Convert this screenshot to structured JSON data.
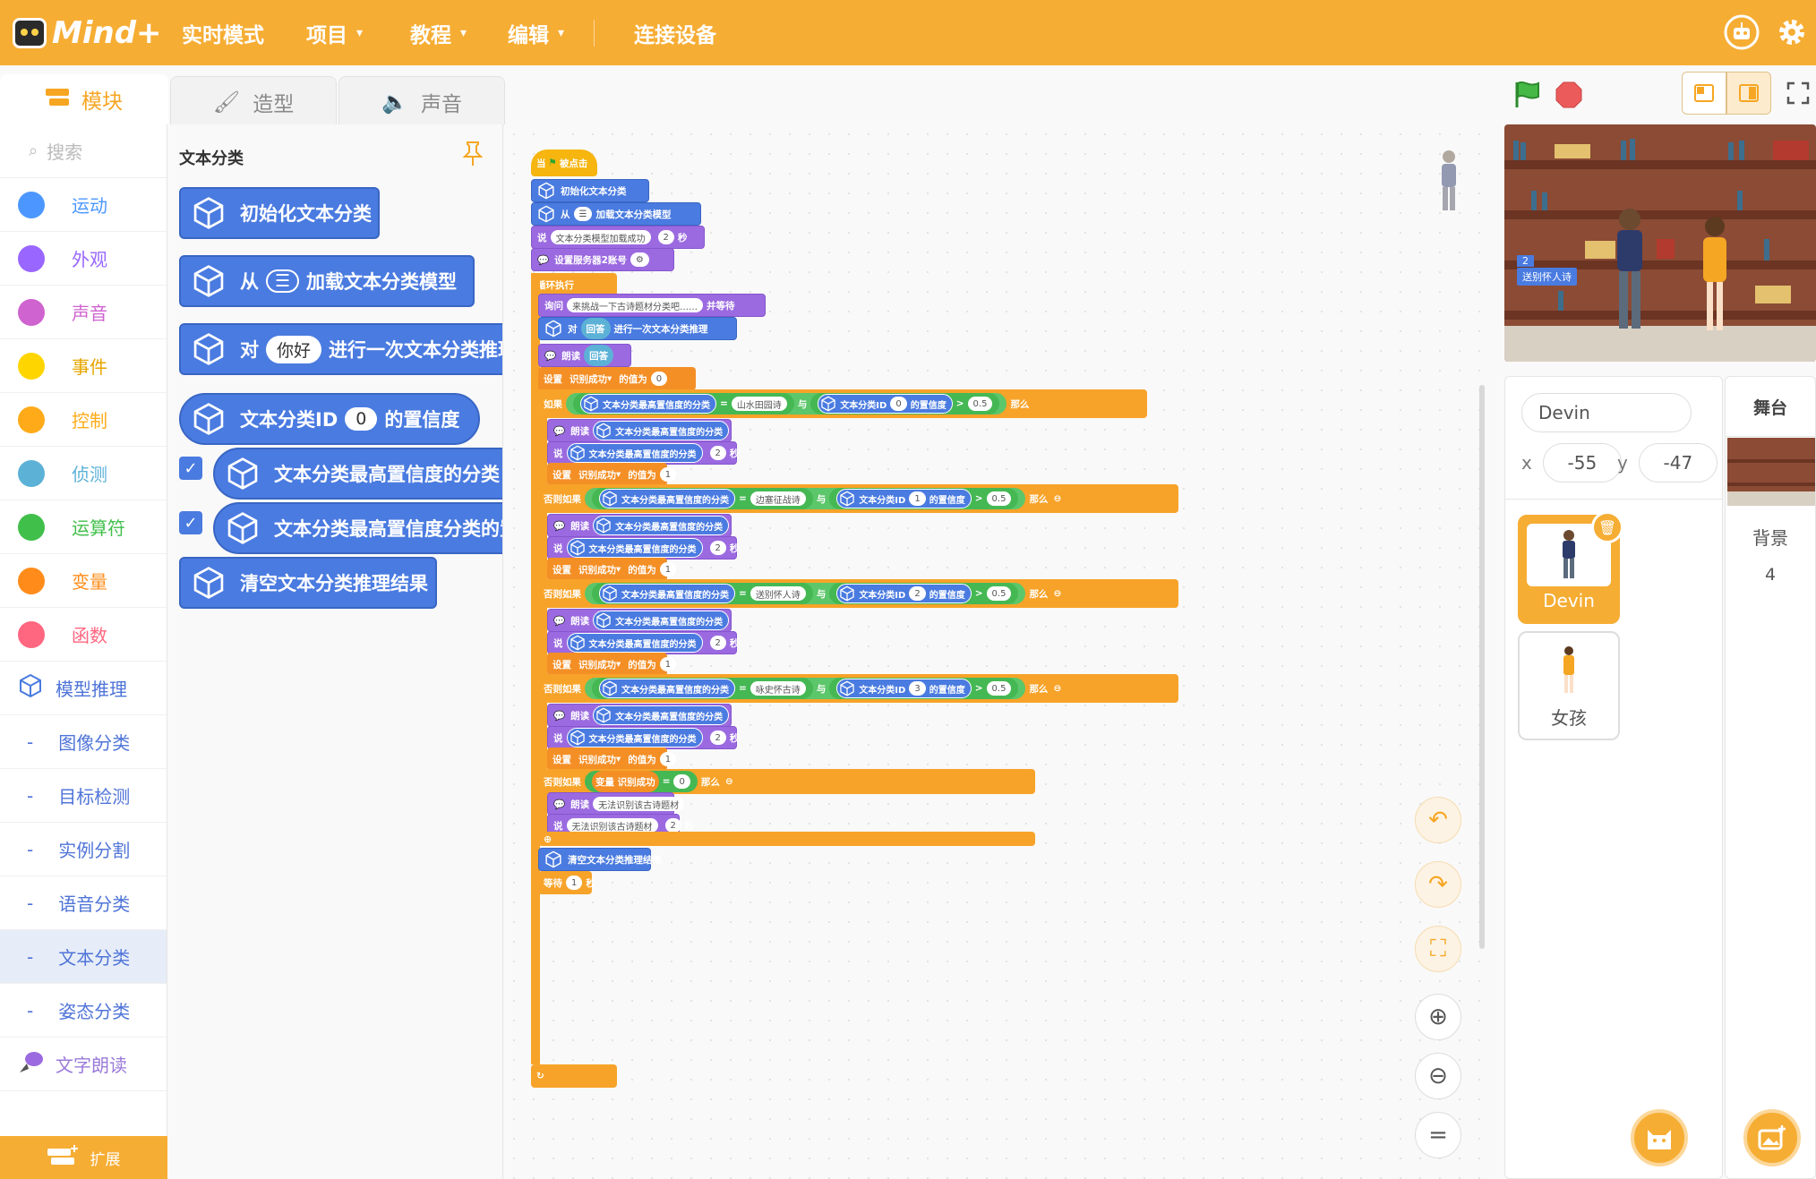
{
  "app": {
    "logo": "Mind+"
  },
  "topbar": {
    "menus": [
      "实时模式",
      "项目",
      "教程",
      "编辑",
      "连接设备"
    ],
    "caret": "▾",
    "icons": [
      "robot-icon",
      "gear-icon"
    ]
  },
  "tabs": [
    "模块",
    "造型",
    "声音"
  ],
  "categories": {
    "search_placeholder": "搜索",
    "items": [
      {
        "label": "运动",
        "color": "#4c97ff"
      },
      {
        "label": "外观",
        "color": "#9966ff"
      },
      {
        "label": "声音",
        "color": "#cf63cf"
      },
      {
        "label": "事件",
        "color": "#ffd500"
      },
      {
        "label": "控制",
        "color": "#ffab19"
      },
      {
        "label": "侦测",
        "color": "#5cb1d6"
      },
      {
        "label": "运算符",
        "color": "#40bf4a"
      },
      {
        "label": "变量",
        "color": "#ff8c1a"
      },
      {
        "label": "函数",
        "color": "#ff6680"
      }
    ],
    "model": "模型推理",
    "sub": [
      "图像分类",
      "目标检测",
      "实例分割",
      "语音分类",
      "文本分类",
      "姿态分类"
    ],
    "sub_marker": "-",
    "speech": "文字朗读",
    "extension": "扩展"
  },
  "palette": {
    "title": "文本分类",
    "blocks": {
      "init": "初始化文本分类",
      "load_from": "从",
      "load_rest": "加载文本分类模型",
      "infer_for": "对",
      "infer_val": "你好",
      "infer_rest": "进行一次文本分类推理",
      "conf_id": "文本分类ID",
      "conf_val": "0",
      "conf_rest": "的置信度",
      "top_class": "文本分类最高置信度的分类",
      "top_conf": "文本分类最高置信度分类的置信度",
      "clear": "清空文本分类推理结果",
      "check": "✓"
    }
  },
  "script": {
    "hat_when": "当",
    "hat_clicked": "被点击",
    "init": "初始化文本分类",
    "load_from": "从",
    "load_rest": "加载文本分类模型",
    "say": "说",
    "say_loaded": "文本分类模型加载成功",
    "secs_val": "2",
    "secs": "秒",
    "set_server": "设置服务器2账号",
    "forever": "循环执行",
    "ask": "询问",
    "ask_text": "来挑战一下古诗题材分类吧……",
    "ask_wait": "并等待",
    "infer_for": "对",
    "answer": "回答",
    "infer_rest": "进行一次文本分类推理",
    "speak": "朗读",
    "set": "设置",
    "var": "识别成功",
    "var_caret": "▾",
    "value_to": "的值为",
    "zero": "0",
    "one": "1",
    "if": "如果",
    "else_if": "否则如果",
    "top_class": "文本分类最高置信度的分类",
    "eq": "=",
    "gt": ">",
    "and": "与",
    "conf_id": "文本分类ID",
    "conf_rest": "的置信度",
    "threshold": "0.5",
    "then": "那么",
    "minus": "⊖",
    "plus": "⊕",
    "ids": [
      "0",
      "1",
      "2",
      "3"
    ],
    "labels": [
      "山水田园诗",
      "边塞征战诗",
      "送别怀人诗",
      "咏史怀古诗"
    ],
    "var_label": "变量",
    "fail_text": "无法识别该古诗题材",
    "clear": "清空文本分类推理结果",
    "wait": "等待",
    "wait_val": "1",
    "loop_arrow": "↻"
  },
  "stage": {
    "var_value": "2",
    "var_name": "送别怀人诗"
  },
  "sprite_panel": {
    "name": "Devin",
    "x_label": "x",
    "x": "-55",
    "y_label": "y",
    "y": "-47",
    "sprites": [
      "Devin",
      "女孩"
    ],
    "delete_icon": "🗑"
  },
  "backdrop_panel": {
    "title": "舞台",
    "label": "背景",
    "count": "4"
  },
  "tools": {
    "undo": "↶",
    "redo": "↷",
    "crop": "⛶",
    "zoom_in": "⊕",
    "zoom_out": "⊖",
    "reset": "="
  }
}
